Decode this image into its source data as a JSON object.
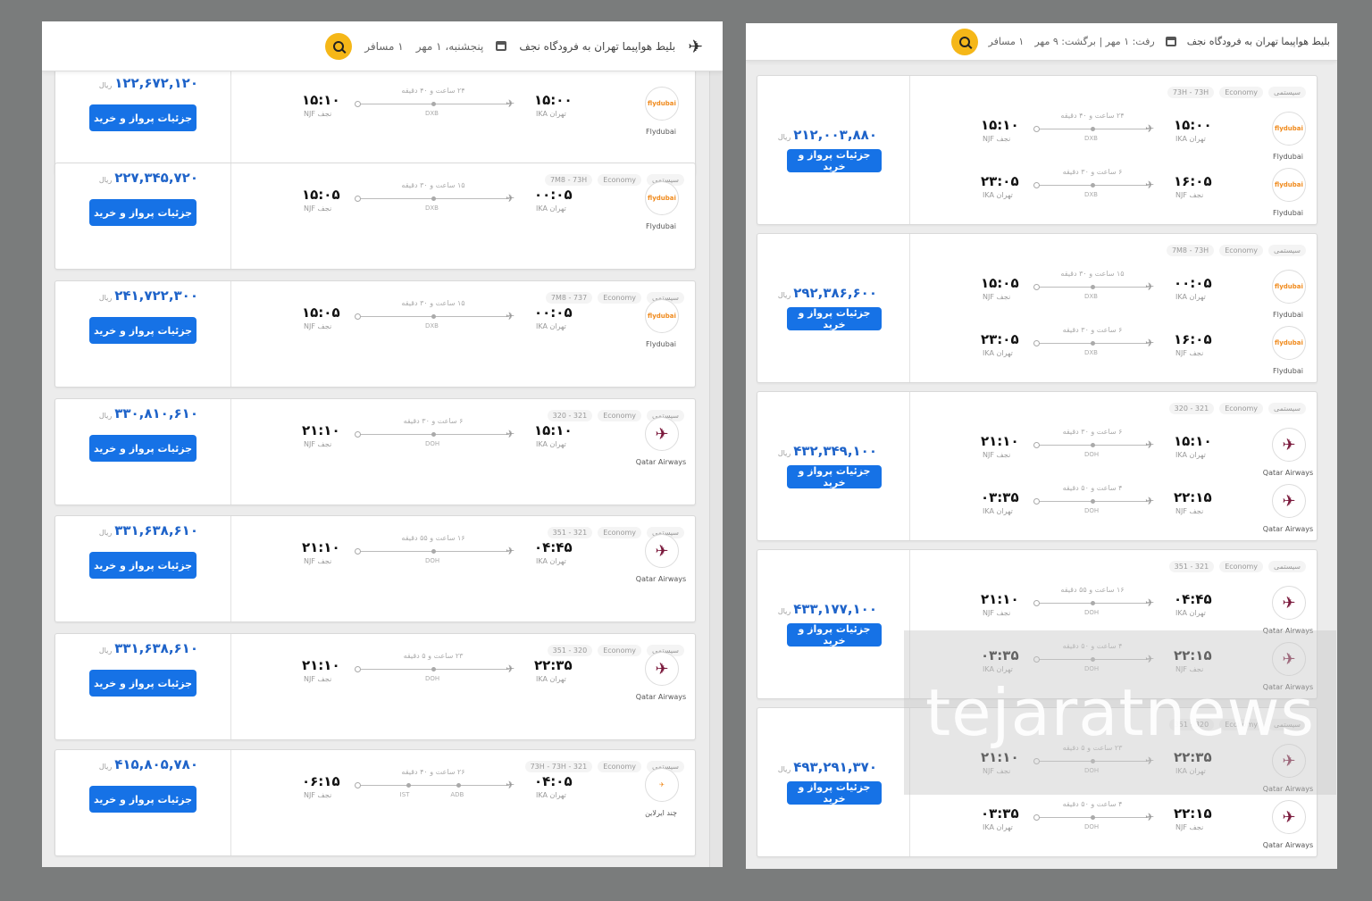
{
  "left": {
    "header": {
      "route": "بلیط هواپیما تهران به فرودگاه نجف",
      "date": "پنجشنبه، ۱ مهر",
      "passengers": "۱ مسافر"
    },
    "cards": [
      {
        "price": "۱۲۲,۶۷۲,۱۲۰",
        "tags": [],
        "legs": [
          {
            "airline": "Flydubai",
            "logo": "flydubai",
            "dep_time": "۱۵:۰۰",
            "dep_apt": "تهران IKA",
            "arr_time": "۱۵:۱۰",
            "arr_apt": "نجف NJF",
            "duration": "۲۴ ساعت و ۴۰ دقیقه",
            "stops": [
              "DXB"
            ]
          }
        ]
      },
      {
        "price": "۲۲۷,۳۴۵,۷۲۰",
        "tags": [
          "سیستمی",
          "Economy",
          "7M8 - 73H"
        ],
        "legs": [
          {
            "airline": "Flydubai",
            "logo": "flydubai",
            "dep_time": "۰۰:۰۵",
            "dep_apt": "تهران IKA",
            "arr_time": "۱۵:۰۵",
            "arr_apt": "نجف NJF",
            "duration": "۱۵ ساعت و ۳۰ دقیقه",
            "stops": [
              "DXB"
            ]
          }
        ]
      },
      {
        "price": "۲۴۱,۷۲۲,۳۰۰",
        "tags": [
          "سیستمی",
          "Economy",
          "7M8 - 737"
        ],
        "legs": [
          {
            "airline": "Flydubai",
            "logo": "flydubai",
            "dep_time": "۰۰:۰۵",
            "dep_apt": "تهران IKA",
            "arr_time": "۱۵:۰۵",
            "arr_apt": "نجف NJF",
            "duration": "۱۵ ساعت و ۳۰ دقیقه",
            "stops": [
              "DXB"
            ]
          }
        ]
      },
      {
        "price": "۳۳۰,۸۱۰,۶۱۰",
        "tags": [
          "سیستمی",
          "Economy",
          "321 - 320"
        ],
        "legs": [
          {
            "airline": "Qatar Airways",
            "logo": "qatar",
            "dep_time": "۱۵:۱۰",
            "dep_apt": "تهران IKA",
            "arr_time": "۲۱:۱۰",
            "arr_apt": "نجف NJF",
            "duration": "۶ ساعت و ۳۰ دقیقه",
            "stops": [
              "DOH"
            ]
          }
        ]
      },
      {
        "price": "۳۳۱,۶۳۸,۶۱۰",
        "tags": [
          "سیستمی",
          "Economy",
          "321 - 351"
        ],
        "legs": [
          {
            "airline": "Qatar Airways",
            "logo": "qatar",
            "dep_time": "۰۴:۴۵",
            "dep_apt": "تهران IKA",
            "arr_time": "۲۱:۱۰",
            "arr_apt": "نجف NJF",
            "duration": "۱۶ ساعت و ۵۵ دقیقه",
            "stops": [
              "DOH"
            ]
          }
        ]
      },
      {
        "price": "۳۳۱,۶۳۸,۶۱۰",
        "tags": [
          "سیستمی",
          "Economy",
          "320 - 351"
        ],
        "legs": [
          {
            "airline": "Qatar Airways",
            "logo": "qatar",
            "dep_time": "۲۲:۳۵",
            "dep_apt": "تهران IKA",
            "arr_time": "۲۱:۱۰",
            "arr_apt": "نجف NJF",
            "duration": "۲۳ ساعت و ۵ دقیقه",
            "stops": [
              "DOH"
            ]
          }
        ]
      },
      {
        "price": "۴۱۵,۸۰۵,۷۸۰",
        "tags": [
          "سیستمی",
          "Economy",
          "73H - 73H - 321"
        ],
        "legs": [
          {
            "airline": "چند ایرلاین",
            "logo": "multi",
            "dep_time": "۰۴:۰۵",
            "dep_apt": "تهران IKA",
            "arr_time": "۰۶:۱۵",
            "arr_apt": "نجف NJF",
            "duration": "۲۶ ساعت و ۴۰ دقیقه",
            "stops": [
              "IST",
              "ADB"
            ]
          }
        ]
      }
    ]
  },
  "right": {
    "header": {
      "route": "بلیط هواپیما تهران به فرودگاه نجف",
      "date": "رفت: ۱ مهر | برگشت: ۹ مهر",
      "passengers": "۱ مسافر"
    },
    "cards": [
      {
        "price": "۲۱۲,۰۰۳,۸۸۰",
        "tags": [
          "سیستمی",
          "Economy",
          "73H - 73H"
        ],
        "legs": [
          {
            "airline": "Flydubai",
            "logo": "flydubai",
            "dep_time": "۱۵:۰۰",
            "dep_apt": "تهران IKA",
            "arr_time": "۱۵:۱۰",
            "arr_apt": "نجف NJF",
            "duration": "۲۴ ساعت و ۴۰ دقیقه",
            "stops": [
              "DXB"
            ]
          },
          {
            "airline": "Flydubai",
            "logo": "flydubai",
            "dep_time": "۱۶:۰۵",
            "dep_apt": "نجف NJF",
            "arr_time": "۲۳:۰۵",
            "arr_apt": "تهران IKA",
            "duration": "۶ ساعت و ۳۰ دقیقه",
            "stops": [
              "DXB"
            ]
          }
        ]
      },
      {
        "price": "۲۹۲,۳۸۶,۶۰۰",
        "tags": [
          "سیستمی",
          "Economy",
          "7M8 - 73H"
        ],
        "legs": [
          {
            "airline": "Flydubai",
            "logo": "flydubai",
            "dep_time": "۰۰:۰۵",
            "dep_apt": "تهران IKA",
            "arr_time": "۱۵:۰۵",
            "arr_apt": "نجف NJF",
            "duration": "۱۵ ساعت و ۳۰ دقیقه",
            "stops": [
              "DXB"
            ]
          },
          {
            "airline": "Flydubai",
            "logo": "flydubai",
            "dep_time": "۱۶:۰۵",
            "dep_apt": "نجف NJF",
            "arr_time": "۲۳:۰۵",
            "arr_apt": "تهران IKA",
            "duration": "۶ ساعت و ۳۰ دقیقه",
            "stops": [
              "DXB"
            ]
          }
        ]
      },
      {
        "price": "۴۳۲,۳۴۹,۱۰۰",
        "tags": [
          "سیستمی",
          "Economy",
          "321 - 320"
        ],
        "legs": [
          {
            "airline": "Qatar Airways",
            "logo": "qatar",
            "dep_time": "۱۵:۱۰",
            "dep_apt": "تهران IKA",
            "arr_time": "۲۱:۱۰",
            "arr_apt": "نجف NJF",
            "duration": "۶ ساعت و ۳۰ دقیقه",
            "stops": [
              "DOH"
            ]
          },
          {
            "airline": "Qatar Airways",
            "logo": "qatar",
            "dep_time": "۲۲:۱۵",
            "dep_apt": "نجف NJF",
            "arr_time": "۰۳:۳۵",
            "arr_apt": "تهران IKA",
            "duration": "۴ ساعت و ۵۰ دقیقه",
            "stops": [
              "DOH"
            ]
          }
        ]
      },
      {
        "price": "۴۳۳,۱۷۷,۱۰۰",
        "tags": [
          "سیستمی",
          "Economy",
          "321 - 351"
        ],
        "legs": [
          {
            "airline": "Qatar Airways",
            "logo": "qatar",
            "dep_time": "۰۴:۴۵",
            "dep_apt": "تهران IKA",
            "arr_time": "۲۱:۱۰",
            "arr_apt": "نجف NJF",
            "duration": "۱۶ ساعت و ۵۵ دقیقه",
            "stops": [
              "DOH"
            ]
          },
          {
            "airline": "Qatar Airways",
            "logo": "qatar",
            "dep_time": "۲۲:۱۵",
            "dep_apt": "نجف NJF",
            "arr_time": "۰۳:۳۵",
            "arr_apt": "تهران IKA",
            "duration": "۴ ساعت و ۵۰ دقیقه",
            "stops": [
              "DOH"
            ]
          }
        ]
      },
      {
        "price": "۴۹۳,۲۹۱,۳۷۰",
        "tags": [
          "سیستمی",
          "Economy",
          "320 - 351"
        ],
        "legs": [
          {
            "airline": "Qatar Airways",
            "logo": "qatar",
            "dep_time": "۲۲:۳۵",
            "dep_apt": "تهران IKA",
            "arr_time": "۲۱:۱۰",
            "arr_apt": "نجف NJF",
            "duration": "۲۳ ساعت و ۵ دقیقه",
            "stops": [
              "DOH"
            ]
          },
          {
            "airline": "Qatar Airways",
            "logo": "qatar",
            "dep_time": "۲۲:۱۵",
            "dep_apt": "نجف NJF",
            "arr_time": "۰۳:۳۵",
            "arr_apt": "تهران IKA",
            "duration": "۴ ساعت و ۵۰ دقیقه",
            "stops": [
              "DOH"
            ]
          }
        ]
      }
    ]
  },
  "common": {
    "buy_label": "جزئیات پرواز و خرید",
    "currency": "ریال",
    "logo_text_flydubai": "flydubai"
  },
  "watermark": "tejaratnews",
  "colors": {
    "accent": "#1672e6",
    "price": "#1e63c9",
    "search": "#f5b718"
  },
  "icons": {
    "plane": "airplane-icon",
    "calendar": "calendar-icon",
    "search": "search-icon"
  }
}
